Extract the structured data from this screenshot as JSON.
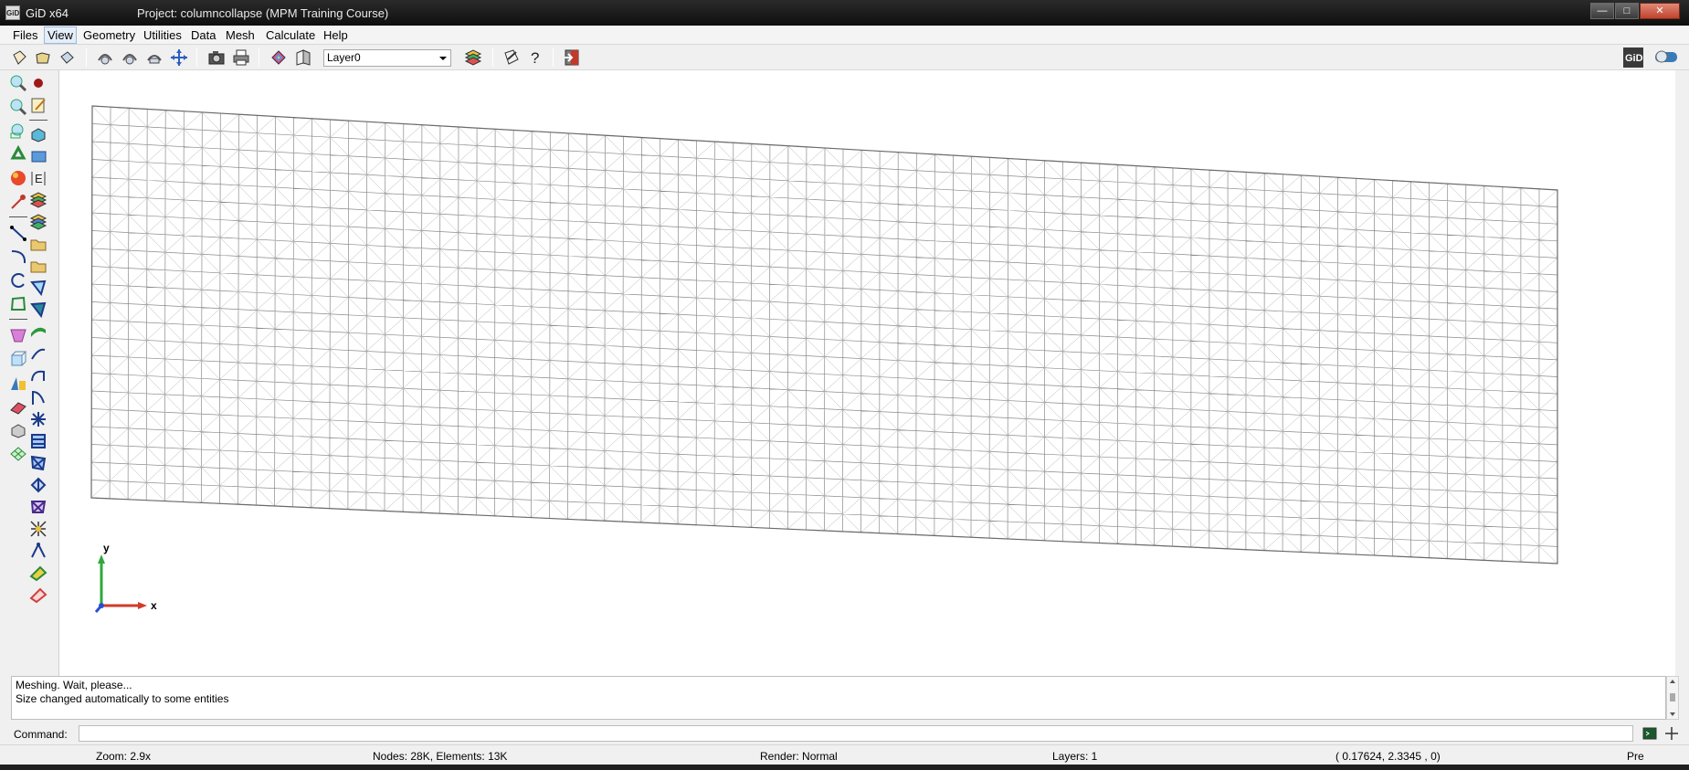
{
  "window": {
    "app_title": "GiD x64",
    "project_title": "Project: columncollapse (MPM Training Course)",
    "minimize_icon": "minimize-icon",
    "maximize_icon": "maximize-icon",
    "close_icon": "close-icon"
  },
  "menu": {
    "items": [
      {
        "label": "Files"
      },
      {
        "label": "View"
      },
      {
        "label": "Geometry"
      },
      {
        "label": "Utilities"
      },
      {
        "label": "Data"
      },
      {
        "label": "Mesh"
      },
      {
        "label": "Calculate"
      },
      {
        "label": "Help"
      }
    ]
  },
  "toolbar": {
    "layer_value": "Layer0"
  },
  "axes": {
    "y_label": "y",
    "x_label": "x"
  },
  "messages": {
    "line1": "Meshing. Wait, please...",
    "line2": "Size changed automatically to some entities"
  },
  "command": {
    "label": "Command:",
    "value": ""
  },
  "status": {
    "zoom": "Zoom: 2.9x",
    "counts": "Nodes: 28K, Elements: 13K",
    "render": "Render: Normal",
    "layers": "Layers: 1",
    "coords": "(  0.17624,  2.3345 ,  0)",
    "mode": "Pre"
  },
  "colors": {
    "mesh_line": "#8a8a8a",
    "axis_x": "#d23a2a",
    "axis_y": "#2fa83a",
    "axis_z": "#2a4fd2"
  }
}
